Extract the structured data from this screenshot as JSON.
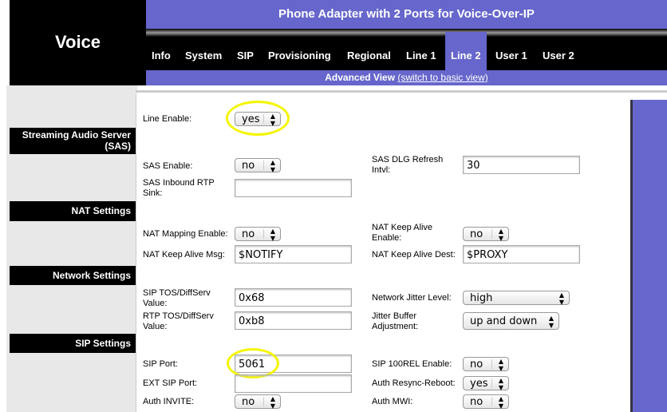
{
  "header": {
    "brand": "Voice",
    "title": "Phone Adapter with 2 Ports for Voice-Over-IP"
  },
  "tabs": [
    "Info",
    "System",
    "SIP",
    "Provisioning",
    "Regional",
    "Line 1",
    "Line 2",
    "User 1",
    "User 2"
  ],
  "active_tab": "Line 2",
  "view": {
    "label": "Advanced View",
    "link": "(switch to basic view)"
  },
  "line_enable": {
    "label": "Line Enable:",
    "value": "yes"
  },
  "sections": [
    "Streaming Audio Server (SAS)",
    "NAT Settings",
    "Network Settings",
    "SIP Settings"
  ],
  "fields": {
    "sas_enable": {
      "label": "SAS Enable:",
      "value": "no"
    },
    "sas_dlg": {
      "label": "SAS DLG Refresh Intvl:",
      "value": "30"
    },
    "sas_rtp": {
      "label": "SAS Inbound RTP Sink:",
      "value": ""
    },
    "nat_map": {
      "label": "NAT Mapping Enable:",
      "value": "no"
    },
    "nat_ka_en": {
      "label": "NAT Keep Alive Enable:",
      "value": "no"
    },
    "nat_ka_msg": {
      "label": "NAT Keep Alive Msg:",
      "value": "$NOTIFY"
    },
    "nat_ka_dest": {
      "label": "NAT Keep Alive Dest:",
      "value": "$PROXY"
    },
    "sip_tos": {
      "label": "SIP TOS/DiffServ Value:",
      "value": "0x68"
    },
    "jitter_level": {
      "label": "Network Jitter Level:",
      "value": "high"
    },
    "rtp_tos": {
      "label": "RTP TOS/DiffServ Value:",
      "value": "0xb8"
    },
    "jitter_adj": {
      "label": "Jitter Buffer Adjustment:",
      "value": "up and down"
    },
    "sip_port": {
      "label": "SIP Port:",
      "value": "5061"
    },
    "sip_100rel": {
      "label": "SIP 100REL Enable:",
      "value": "no"
    },
    "ext_sip_port": {
      "label": "EXT SIP Port:",
      "value": ""
    },
    "auth_resync": {
      "label": "Auth Resync-Reboot:",
      "value": "yes"
    },
    "auth_invite": {
      "label": "Auth INVITE:",
      "value": "no"
    },
    "auth_mwi": {
      "label": "Auth MWI:",
      "value": "no"
    }
  },
  "colors": {
    "accent": "#6666cc",
    "highlight": "#f5f500"
  }
}
